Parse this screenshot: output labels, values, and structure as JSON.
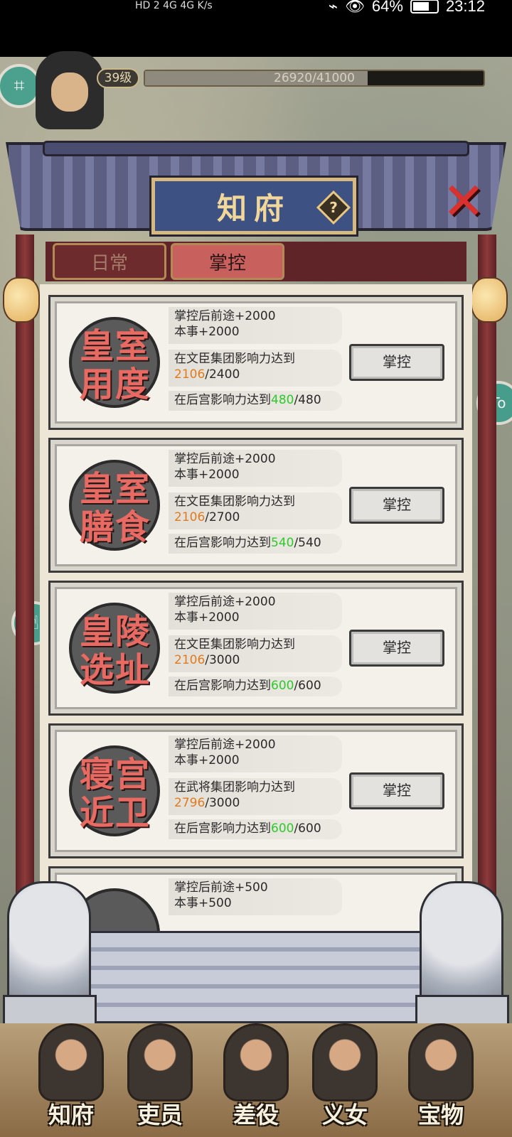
{
  "status_bar": {
    "network": "HD 2  4G  4G  K/s",
    "battery": "64%",
    "time": "23:12"
  },
  "hud": {
    "level": "39级",
    "exp_text": "26920/41000",
    "exp_progress": 0.657
  },
  "dialog": {
    "title": "知府",
    "help_icon_label": "?",
    "close_icon_label": "✕",
    "tabs": [
      {
        "label": "日常",
        "active": false
      },
      {
        "label": "掌控",
        "active": true
      }
    ]
  },
  "cards": [
    {
      "seal": [
        "皇",
        "室",
        "用",
        "度"
      ],
      "reward_line1": "掌控后前途+2000",
      "reward_line2": "本事+2000",
      "req1_prefix": "在文臣集团影响力达到",
      "req1_current": "2106",
      "req1_target": "/2400",
      "req2_prefix": "在后宫影响力达到",
      "req2_current": "480",
      "req2_target": "/480",
      "button": "掌控"
    },
    {
      "seal": [
        "皇",
        "室",
        "膳",
        "食"
      ],
      "reward_line1": "掌控后前途+2000",
      "reward_line2": "本事+2000",
      "req1_prefix": "在文臣集团影响力达到",
      "req1_current": "2106",
      "req1_target": "/2700",
      "req2_prefix": "在后宫影响力达到",
      "req2_current": "540",
      "req2_target": "/540",
      "button": "掌控"
    },
    {
      "seal": [
        "皇",
        "陵",
        "选",
        "址"
      ],
      "reward_line1": "掌控后前途+2000",
      "reward_line2": "本事+2000",
      "req1_prefix": "在文臣集团影响力达到",
      "req1_current": "2106",
      "req1_target": "/3000",
      "req2_prefix": "在后宫影响力达到",
      "req2_current": "600",
      "req2_target": "/600",
      "button": "掌控"
    },
    {
      "seal": [
        "寝",
        "宫",
        "近",
        "卫"
      ],
      "reward_line1": "掌控后前途+2000",
      "reward_line2": "本事+2000",
      "req1_prefix": "在武将集团影响力达到",
      "req1_current": "2796",
      "req1_target": "/3000",
      "req2_prefix": "在后宫影响力达到",
      "req2_current": "600",
      "req2_target": "/600",
      "button": "掌控"
    },
    {
      "reward_line1": "掌控后前途+500",
      "reward_line2": "本事+500"
    }
  ],
  "bottom_nav": [
    {
      "label": "知府"
    },
    {
      "label": "吏员"
    },
    {
      "label": "差役"
    },
    {
      "label": "义女"
    },
    {
      "label": "宝物"
    }
  ],
  "float_buttons": {
    "top_left": "capture-icon",
    "left": "touch-icon",
    "right": "To"
  }
}
